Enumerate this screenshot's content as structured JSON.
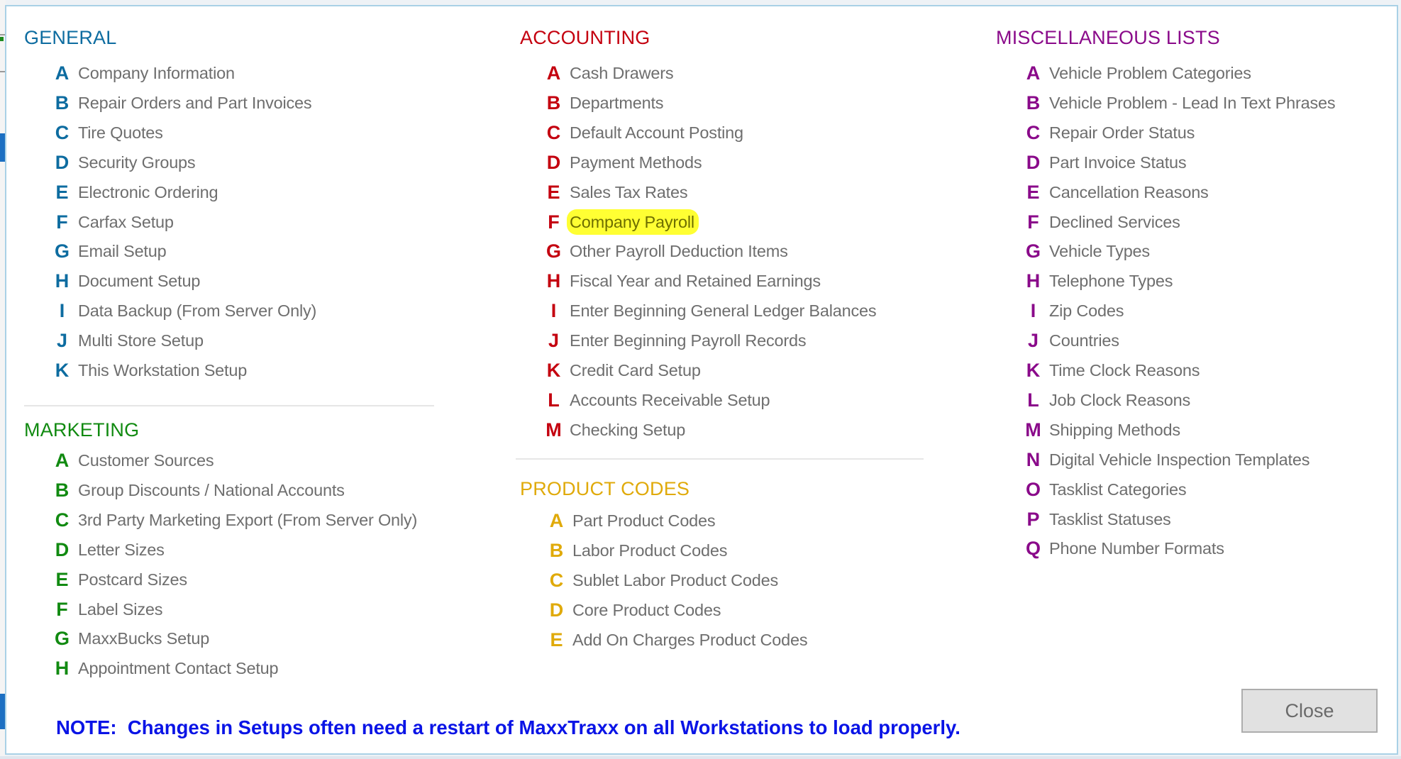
{
  "sections": {
    "general": {
      "title": "GENERAL",
      "items": [
        {
          "key": "A",
          "label": "Company Information"
        },
        {
          "key": "B",
          "label": "Repair Orders and Part Invoices"
        },
        {
          "key": "C",
          "label": "Tire Quotes"
        },
        {
          "key": "D",
          "label": "Security Groups"
        },
        {
          "key": "E",
          "label": "Electronic Ordering"
        },
        {
          "key": "F",
          "label": "Carfax Setup"
        },
        {
          "key": "G",
          "label": "Email Setup"
        },
        {
          "key": "H",
          "label": "Document Setup"
        },
        {
          "key": "I",
          "label": "Data Backup (From Server Only)"
        },
        {
          "key": "J",
          "label": "Multi Store Setup"
        },
        {
          "key": "K",
          "label": "This Workstation Setup"
        }
      ]
    },
    "marketing": {
      "title": "MARKETING",
      "items": [
        {
          "key": "A",
          "label": "Customer Sources"
        },
        {
          "key": "B",
          "label": "Group Discounts / National Accounts"
        },
        {
          "key": "C",
          "label": "3rd Party Marketing Export (From Server Only)"
        },
        {
          "key": "D",
          "label": "Letter Sizes"
        },
        {
          "key": "E",
          "label": "Postcard Sizes"
        },
        {
          "key": "F",
          "label": "Label Sizes"
        },
        {
          "key": "G",
          "label": "MaxxBucks Setup"
        },
        {
          "key": "H",
          "label": "Appointment Contact Setup"
        }
      ]
    },
    "accounting": {
      "title": "ACCOUNTING",
      "items": [
        {
          "key": "A",
          "label": "Cash Drawers"
        },
        {
          "key": "B",
          "label": "Departments"
        },
        {
          "key": "C",
          "label": "Default Account Posting"
        },
        {
          "key": "D",
          "label": "Payment Methods"
        },
        {
          "key": "E",
          "label": "Sales Tax Rates"
        },
        {
          "key": "F",
          "label": "Company Payroll",
          "highlighted": true
        },
        {
          "key": "G",
          "label": "Other Payroll Deduction Items"
        },
        {
          "key": "H",
          "label": "Fiscal Year and Retained Earnings"
        },
        {
          "key": "I",
          "label": "Enter Beginning General Ledger Balances"
        },
        {
          "key": "J",
          "label": "Enter Beginning Payroll Records"
        },
        {
          "key": "K",
          "label": "Credit Card Setup"
        },
        {
          "key": "L",
          "label": "Accounts Receivable Setup"
        },
        {
          "key": "M",
          "label": "Checking Setup"
        }
      ]
    },
    "product_codes": {
      "title": "PRODUCT CODES",
      "items": [
        {
          "key": "A",
          "label": "Part Product Codes"
        },
        {
          "key": "B",
          "label": "Labor Product Codes"
        },
        {
          "key": "C",
          "label": "Sublet Labor Product Codes"
        },
        {
          "key": "D",
          "label": "Core Product Codes"
        },
        {
          "key": "E",
          "label": "Add On Charges Product Codes"
        }
      ]
    },
    "misc_lists": {
      "title": "MISCELLANEOUS LISTS",
      "items": [
        {
          "key": "A",
          "label": "Vehicle Problem Categories"
        },
        {
          "key": "B",
          "label": "Vehicle Problem - Lead In Text Phrases"
        },
        {
          "key": "C",
          "label": "Repair Order Status"
        },
        {
          "key": "D",
          "label": "Part Invoice Status"
        },
        {
          "key": "E",
          "label": "Cancellation Reasons"
        },
        {
          "key": "F",
          "label": "Declined Services"
        },
        {
          "key": "G",
          "label": "Vehicle Types"
        },
        {
          "key": "H",
          "label": "Telephone Types"
        },
        {
          "key": "I",
          "label": "Zip Codes"
        },
        {
          "key": "J",
          "label": "Countries"
        },
        {
          "key": "K",
          "label": "Time Clock Reasons"
        },
        {
          "key": "L",
          "label": "Job Clock Reasons"
        },
        {
          "key": "M",
          "label": "Shipping Methods"
        },
        {
          "key": "N",
          "label": "Digital Vehicle Inspection Templates"
        },
        {
          "key": "O",
          "label": "Tasklist Categories"
        },
        {
          "key": "P",
          "label": "Tasklist Statuses"
        },
        {
          "key": "Q",
          "label": "Phone Number Formats"
        }
      ]
    }
  },
  "colors": {
    "general": "#0d6ca0",
    "marketing": "#118a11",
    "accounting": "#c4000f",
    "product_codes": "#e0aa0a",
    "misc_lists": "#8a0a8a",
    "note": "#0a14e6",
    "highlight": "#ffff33"
  },
  "note": "NOTE:  Changes in Setups often need a restart of MaxxTraxx on all Workstations to load properly.",
  "close_label": "Close"
}
